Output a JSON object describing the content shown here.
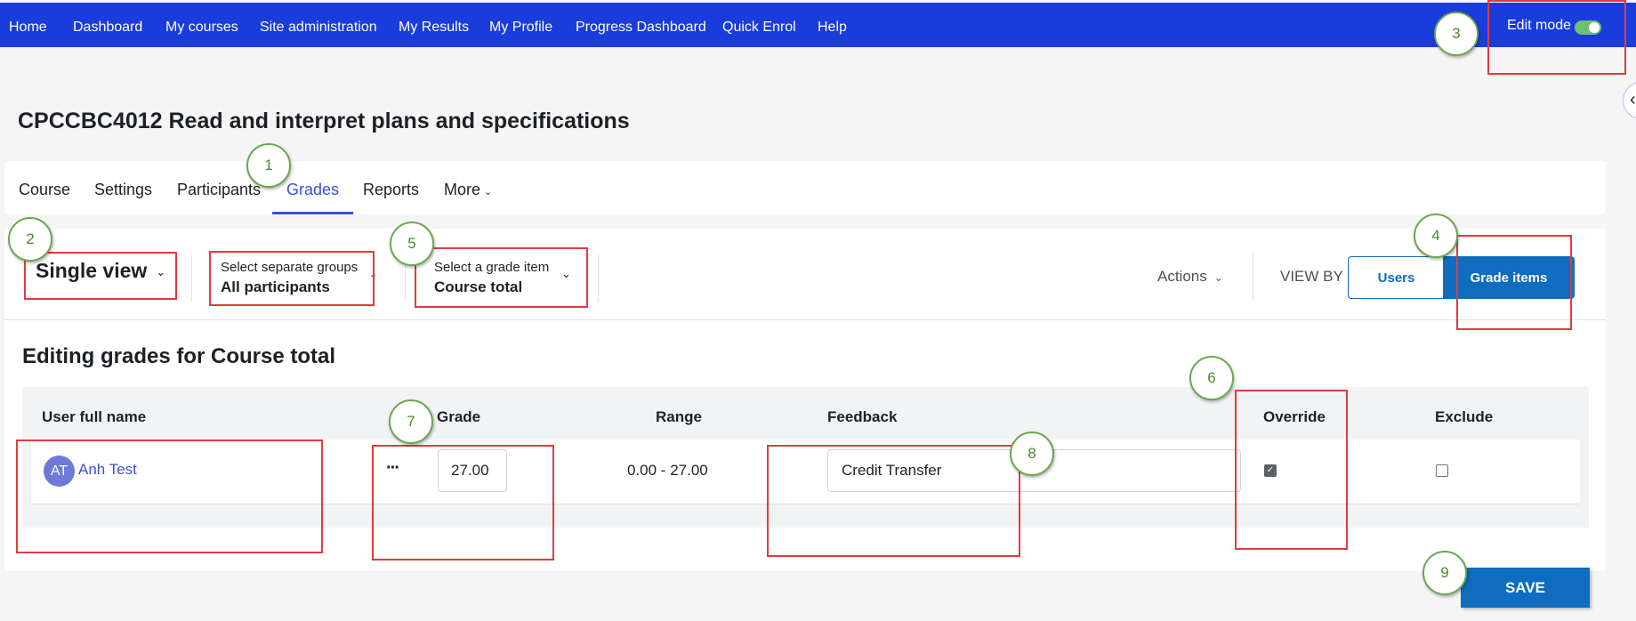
{
  "navbar": {
    "items": [
      "Home",
      "Dashboard",
      "My courses",
      "Site administration",
      "My Results",
      "My Profile",
      "Progress Dashboard",
      "Quick Enrol",
      "Help"
    ],
    "edit_mode_label": "Edit mode",
    "edit_mode_on": true
  },
  "page": {
    "title": "CPCCBC4012 Read and interpret plans and specifications"
  },
  "secondary_nav": {
    "items": [
      "Course",
      "Settings",
      "Participants",
      "Grades",
      "Reports",
      "More"
    ],
    "active": "Grades"
  },
  "toolbar": {
    "report_selector": "Single view",
    "group_selector": {
      "label": "Select separate groups",
      "value": "All participants"
    },
    "grade_item_selector": {
      "label": "Select a grade item",
      "value": "Course total"
    },
    "actions_label": "Actions",
    "view_by_label": "VIEW BY",
    "view_by_users": "Users",
    "view_by_grade_items": "Grade items",
    "view_by_active": "Grade items"
  },
  "grades": {
    "heading": "Editing grades for Course total",
    "columns": [
      "User full name",
      "Grade",
      "Range",
      "Feedback",
      "Override",
      "Exclude"
    ],
    "rows": [
      {
        "initials": "AT",
        "name": "Anh Test",
        "grade": "27.00",
        "range": "0.00 - 27.00",
        "feedback": "Credit Transfer",
        "override": true,
        "exclude": false
      }
    ]
  },
  "save_label": "SAVE",
  "annotations": [
    "1",
    "2",
    "3",
    "4",
    "5",
    "6",
    "7",
    "8",
    "9"
  ],
  "colors": {
    "navbar": "#1a3cdb",
    "primary": "#0f6cbf",
    "link": "#3d4ed8",
    "annotation_box": "#e03c3c",
    "annotation_circle": "#6aa84f"
  }
}
